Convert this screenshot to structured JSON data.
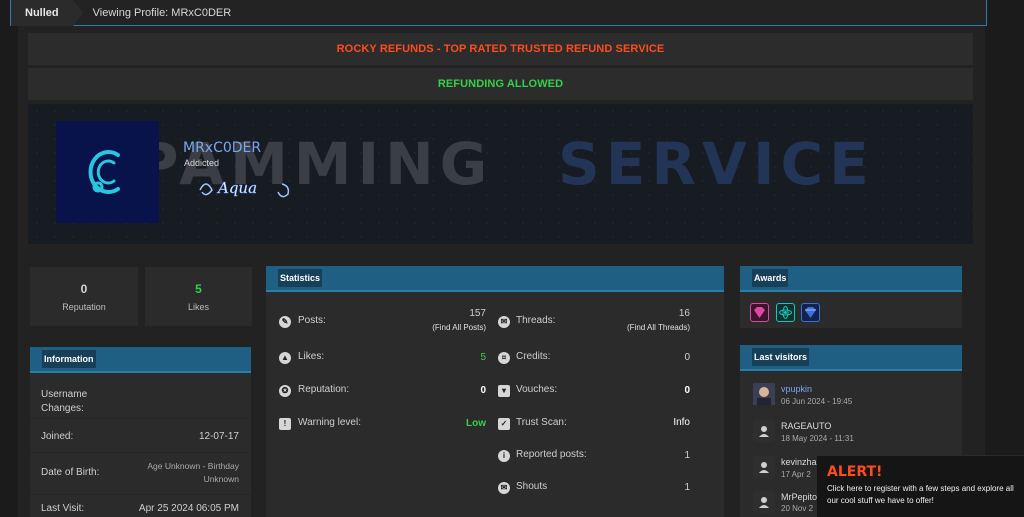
{
  "breadcrumb": {
    "home": "Nulled",
    "current": "Viewing Profile: MRxC0DER"
  },
  "banners": {
    "one": "ROCKY REFUNDS - TOP RATED TRUSTED REFUND SERVICE",
    "two": "REFUNDING ALLOWED"
  },
  "cover": {
    "word_a": "PAMMING",
    "word_b": "SERVICE"
  },
  "profile": {
    "username": "MRxC0DER",
    "title": "Addicted",
    "badge_text": "Aqua"
  },
  "quick_stats": [
    {
      "value": "0",
      "label": "Reputation"
    },
    {
      "value": "5",
      "label": "Likes"
    }
  ],
  "information": {
    "header": "Information",
    "rows": [
      {
        "key": "Username Changes:",
        "value": ""
      },
      {
        "key": "Joined:",
        "value": "12-07-17"
      },
      {
        "key": "Date of Birth:",
        "value": "Age Unknown - Birthday Unknown"
      },
      {
        "key": "Last Visit:",
        "value": "Apr 25 2024 06:05 PM"
      }
    ]
  },
  "statistics": {
    "header": "Statistics",
    "left": [
      {
        "icon": "comment-icon",
        "label": "Posts:",
        "value": "157",
        "sub": "(Find All Posts)"
      },
      {
        "icon": "thumbs-up-icon",
        "label": "Likes:",
        "value": "5"
      },
      {
        "icon": "award-ribbon-icon",
        "label": "Reputation:",
        "value": "0"
      },
      {
        "icon": "warning-icon",
        "label": "Warning level:",
        "value": "Low"
      }
    ],
    "right": [
      {
        "icon": "comments-icon",
        "label": "Threads:",
        "value": "16",
        "sub": "(Find All Threads)"
      },
      {
        "icon": "coins-icon",
        "label": "Credits:",
        "value": "0"
      },
      {
        "icon": "cart-icon",
        "label": "Vouches:",
        "value": "0"
      },
      {
        "icon": "checkbox-icon",
        "label": "Trust Scan:",
        "value": "Info"
      },
      {
        "icon": "info-icon",
        "label": "Reported posts:",
        "value": "1"
      },
      {
        "icon": "comments-icon",
        "label": "Shouts",
        "value": "1"
      }
    ]
  },
  "awards": {
    "header": "Awards",
    "items": [
      {
        "icon": "pink-diamond-award-icon",
        "color": "#e0479e"
      },
      {
        "icon": "teal-atom-award-icon",
        "color": "#18c6b5"
      },
      {
        "icon": "blue-gem-award-icon",
        "color": "#3b6fe0"
      }
    ]
  },
  "last_visitors": {
    "header": "Last visitors",
    "items": [
      {
        "name": "vpupkin",
        "date": "06 Jun 2024 - 19:45"
      },
      {
        "name": "RAGEAUTO",
        "date": "18 May 2024 - 11:31"
      },
      {
        "name": "kevinzha",
        "date": "17 Apr 2"
      },
      {
        "name": "MrPepito",
        "date": "20 Nov 2"
      }
    ]
  },
  "alert": {
    "title": "ALERT!",
    "message": "Click here to register with a few steps and explore all our cool stuff we have to offer!"
  },
  "colors": {
    "accent": "#2a7fa8",
    "header_blue": "#1f5f83",
    "green": "#35d04a",
    "orange": "#ff4c1f",
    "username_blue": "#7aa6f0"
  }
}
